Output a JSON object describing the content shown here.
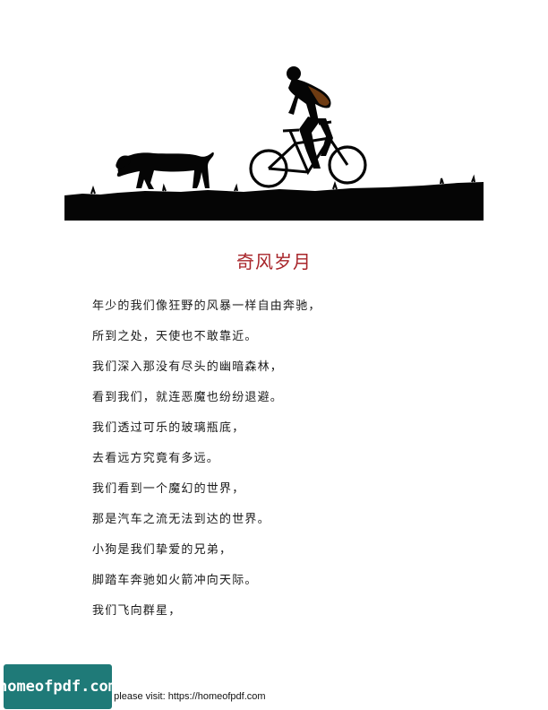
{
  "illustration": {
    "icon": "boy-cycling-with-dog-silhouette"
  },
  "title": "奇风岁月",
  "poem_lines": [
    "年少的我们像狂野的风暴一样自由奔驰，",
    "所到之处，天使也不敢靠近。",
    "我们深入那没有尽头的幽暗森林，",
    "看到我们，就连恶魔也纷纷退避。",
    "我们透过可乐的玻璃瓶底，",
    "去看远方究竟有多远。",
    "我们看到一个魔幻的世界，",
    "那是汽车之流无法到达的世界。",
    "小狗是我们挚爱的兄弟，",
    "脚踏车奔驰如火箭冲向天际。",
    "我们飞向群星，"
  ],
  "footer": {
    "badge_text": "homeofpdf.com",
    "text": "e please visit: https://homeofpdf.com"
  },
  "colors": {
    "title": "#a8252a",
    "badge": "#1f7a78"
  }
}
